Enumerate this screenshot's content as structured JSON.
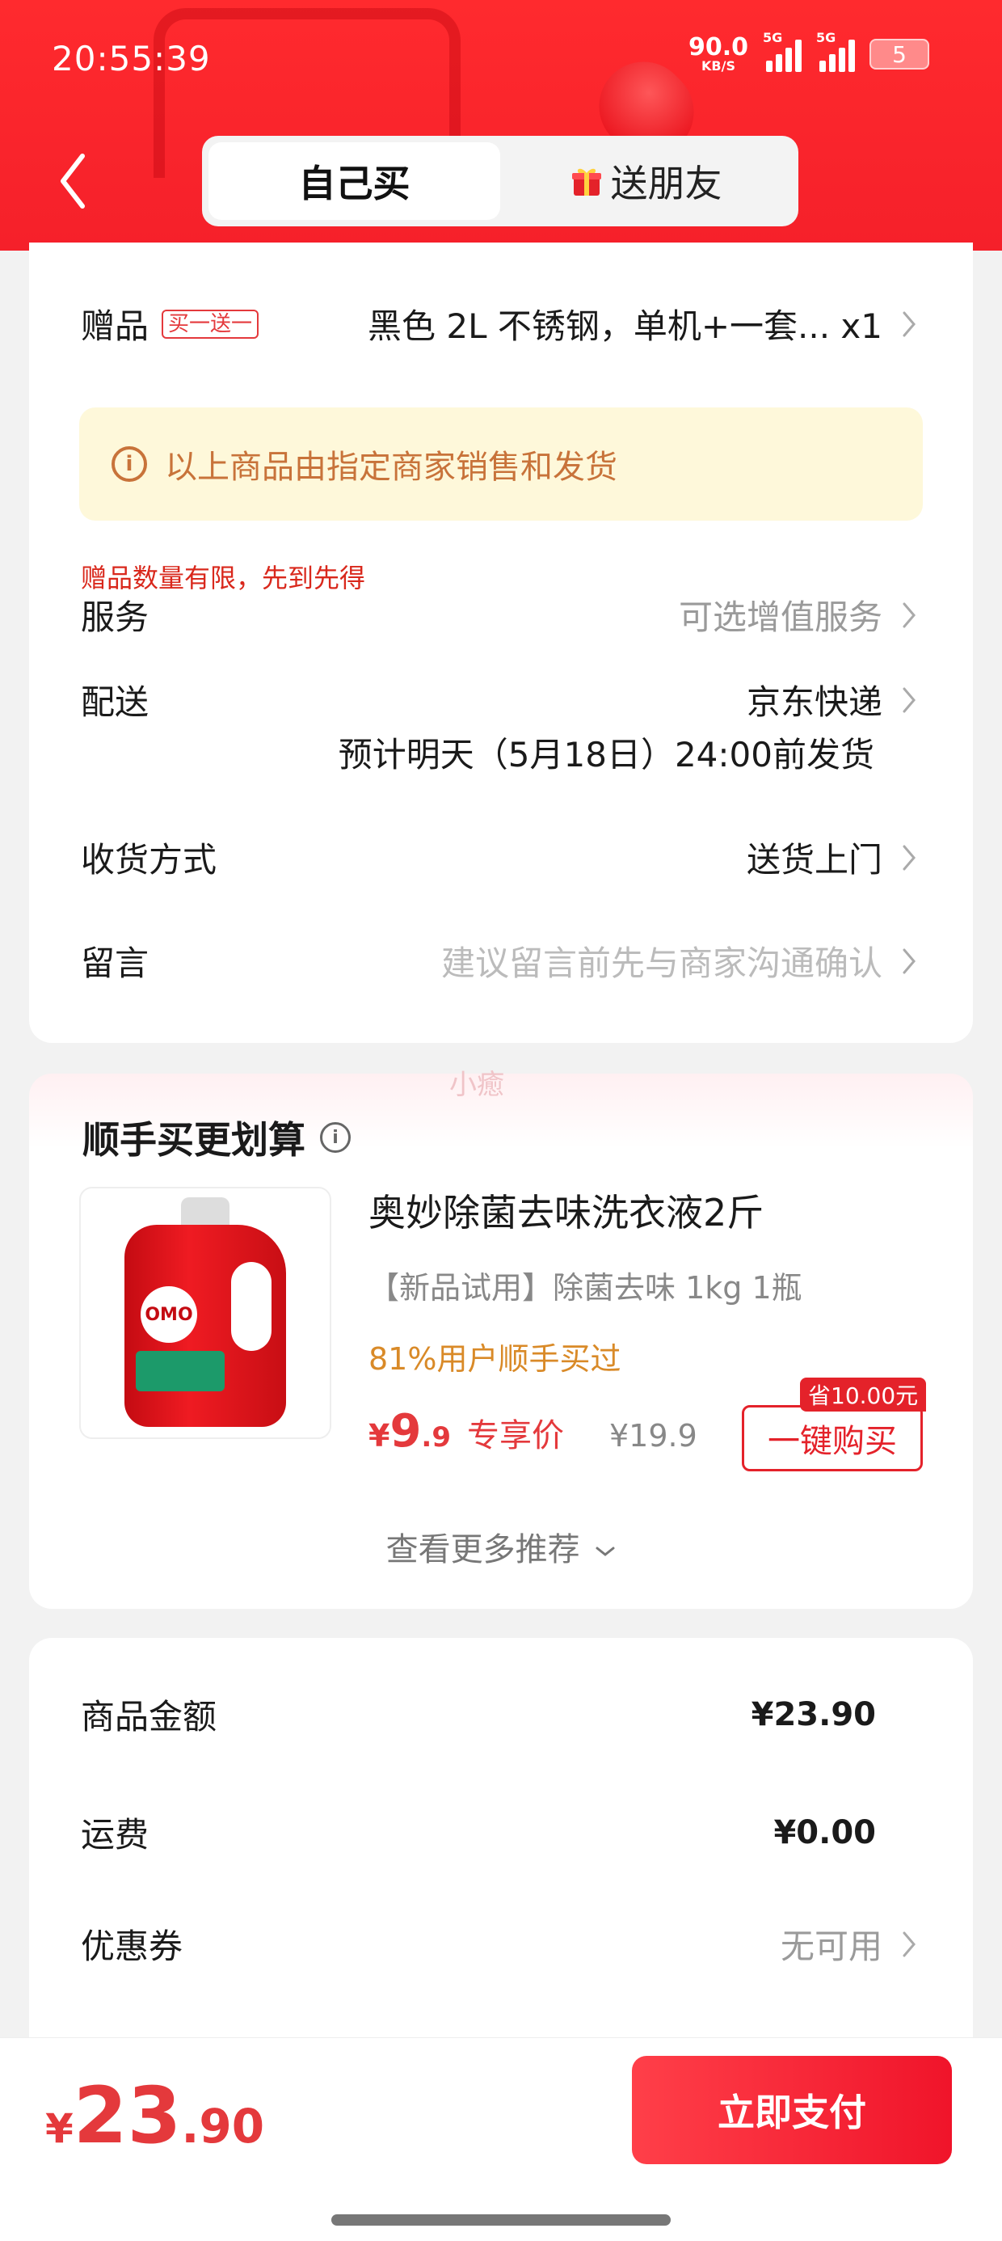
{
  "status_bar": {
    "time": "20:55:39",
    "net_speed": "90.0",
    "net_unit": "KB/S",
    "sig1": "5G",
    "sig2": "5G",
    "battery": "5"
  },
  "header": {
    "tabs": [
      {
        "label": "自己买",
        "active": true
      },
      {
        "label": "送朋友",
        "active": false,
        "icon": "gift-icon"
      }
    ]
  },
  "order": {
    "gift": {
      "label": "赠品",
      "badge": "买一送一",
      "value": "黑色 2L 不锈钢，单机+一套... x1"
    },
    "notice": "以上商品由指定商家销售和发货",
    "warn": "赠品数量有限，先到先得",
    "service": {
      "label": "服务",
      "value": "可选增值服务"
    },
    "delivery": {
      "label": "配送",
      "value": "京东快递",
      "sub": "预计明天（5月18日）24:00前发货"
    },
    "receive": {
      "label": "收货方式",
      "value": "送货上门"
    },
    "message": {
      "label": "留言",
      "placeholder": "建议留言前先与商家沟通确认"
    }
  },
  "addon": {
    "title": "顺手买更划算",
    "watermark": "小癒",
    "product": {
      "name": "奥妙除菌去味洗衣液2斤",
      "spec": "【新品试用】除菌去味 1kg 1瓶",
      "hot": "81%用户顺手买过",
      "price_cur": "¥",
      "price_int": "9",
      "price_dec": ".9",
      "price_tag": "专享价",
      "orig_price": "¥19.9",
      "save_tag": "省10.00元",
      "buy_label": "一键购买",
      "logo_text": "OMO"
    },
    "more": "查看更多推荐"
  },
  "summary": {
    "goods": {
      "label": "商品金额",
      "value": "¥23.90"
    },
    "shipping": {
      "label": "运费",
      "value": "¥0.00"
    },
    "coupon": {
      "label": "优惠券",
      "value": "无可用"
    }
  },
  "footer": {
    "total_cur": "¥",
    "total_int": "23",
    "total_dec": ".90",
    "pay_label": "立即支付"
  },
  "colors": {
    "brand_red": "#e4393c",
    "header_red": "#f5202a",
    "notice_bg": "#fef8da",
    "notice_text": "#c8733a"
  }
}
